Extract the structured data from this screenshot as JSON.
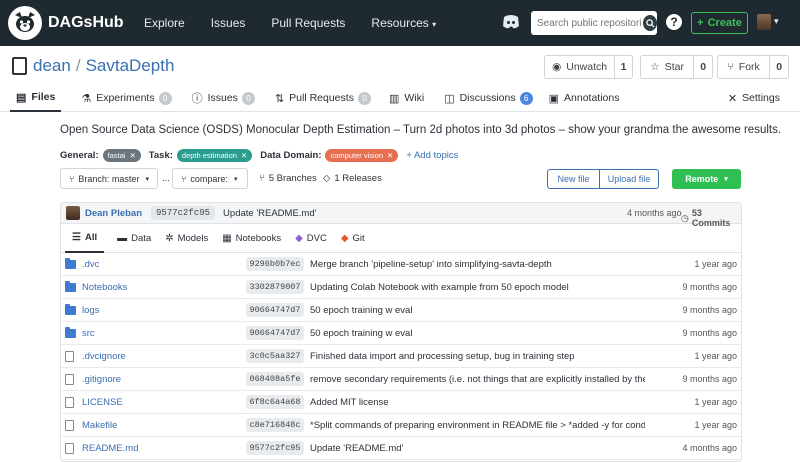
{
  "nav": {
    "brand": "DAGsHub",
    "links": [
      "Explore",
      "Issues",
      "Pull Requests",
      "Resources"
    ],
    "search_placeholder": "Search public repositories...",
    "create_label": "Create",
    "colors": {
      "bar": "#1f2a30",
      "create": "#3ec15a"
    }
  },
  "repo": {
    "owner": "dean",
    "name": "SavtaDepth",
    "watch_label": "Unwatch",
    "watch_count": "1",
    "star_label": "Star",
    "star_count": "0",
    "fork_label": "Fork",
    "fork_count": "0"
  },
  "tabs": [
    {
      "label": "Files",
      "icon": "file-icon"
    },
    {
      "label": "Experiments",
      "badge": "0",
      "icon": "flask-icon"
    },
    {
      "label": "Issues",
      "badge": "0",
      "icon": "issue-icon"
    },
    {
      "label": "Pull Requests",
      "badge": "0",
      "icon": "pull-request-icon"
    },
    {
      "label": "Wiki",
      "icon": "book-icon"
    },
    {
      "label": "Discussions",
      "badge": "6",
      "icon": "discussion-icon"
    },
    {
      "label": "Annotations",
      "icon": "annotation-icon"
    },
    {
      "label": "Settings",
      "icon": "settings-icon"
    }
  ],
  "description": "Open Source Data Science (OSDS) Monocular Depth Estimation – Turn 2d photos into 3d photos – show your grandma the awesome results.",
  "topics": {
    "general_label": "General:",
    "general_tag": "fastai",
    "task_label": "Task:",
    "task_tag": "depth estimation",
    "domain_label": "Data Domain:",
    "domain_tag": "computer vision",
    "add_label": "+ Add topics",
    "colors": {
      "general": "#6c757d",
      "task": "#2a9d8f",
      "domain": "#e76f51"
    }
  },
  "controls": {
    "branch_label": "Branch: master",
    "ellipsis": "...",
    "compare_label": "compare:",
    "branches": "5 Branches",
    "releases": "1 Releases",
    "new_file": "New file",
    "upload_file": "Upload file",
    "remote": "Remote"
  },
  "last_commit": {
    "author": "Dean Pleban",
    "sha": "9577c2fc95",
    "message": "Update 'README.md'",
    "time": "4 months ago",
    "commits": "53 Commits"
  },
  "file_tabs": [
    {
      "label": "All",
      "icon": "list-icon"
    },
    {
      "label": "Data",
      "icon": "database-icon"
    },
    {
      "label": "Models",
      "icon": "models-icon"
    },
    {
      "label": "Notebooks",
      "icon": "notebook-icon"
    },
    {
      "label": "DVC",
      "icon": "dvc-icon"
    },
    {
      "label": "Git",
      "icon": "git-icon"
    }
  ],
  "files": [
    {
      "name": ".dvc",
      "type": "folder",
      "sha": "9296b0b7ec",
      "message": "Merge branch 'pipeline-setup' into simplifying-savta-depth",
      "time": "1 year ago"
    },
    {
      "name": "Notebooks",
      "type": "folder",
      "sha": "3302879007",
      "message": "Updating Colab Notebook with example from 50 epoch model",
      "time": "9 months ago"
    },
    {
      "name": "logs",
      "type": "folder",
      "sha": "90664747d7",
      "message": "50 epoch training w eval",
      "time": "9 months ago"
    },
    {
      "name": "src",
      "type": "folder",
      "sha": "90664747d7",
      "message": "50 epoch training w eval",
      "time": "9 months ago"
    },
    {
      "name": ".dvcignore",
      "type": "file",
      "sha": "3c0c5aa327",
      "message": "Finished data import and processing setup, bug in training step",
      "time": "1 year ago"
    },
    {
      "name": ".gitignore",
      "type": "file",
      "sha": "068408a5fe",
      "message": "remove secondary requirements (i.e. not things that are explicitly installed by the user), fi...",
      "time": "9 months ago"
    },
    {
      "name": "LICENSE",
      "type": "file",
      "sha": "6f8c6a4a68",
      "message": "Added MIT license",
      "time": "1 year ago"
    },
    {
      "name": "Makefile",
      "type": "file",
      "sha": "c8e716848c",
      "message": "*Split commands of preparing environment in README file > *added -y for conda env cre...",
      "time": "1 year ago"
    },
    {
      "name": "README.md",
      "type": "file",
      "sha": "9577c2fc95",
      "message": "Update 'README.md'",
      "time": "4 months ago"
    }
  ]
}
